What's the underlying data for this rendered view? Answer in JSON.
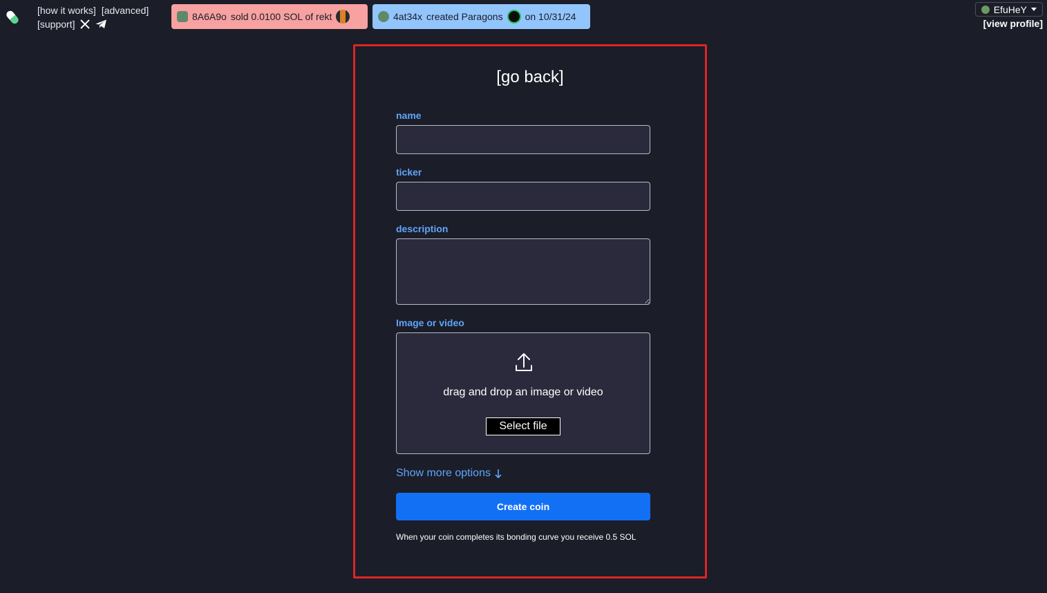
{
  "header": {
    "nav": {
      "how_it_works": "[how it works]",
      "advanced": "[advanced]",
      "support": "[support]"
    },
    "ticker_sell": {
      "user": "8A6A9o",
      "text": "sold 0.0100 SOL of rekt",
      "color": "#f7a1a1"
    },
    "ticker_create": {
      "user": "4at34x",
      "text": "created Paragons",
      "date": "on 10/31/24",
      "color": "#93c5fd"
    },
    "user": {
      "name": "EfuHeY",
      "view_profile": "[view profile]"
    }
  },
  "form": {
    "go_back": "[go back]",
    "name_label": "name",
    "name_value": "",
    "ticker_label": "ticker",
    "ticker_value": "",
    "description_label": "description",
    "description_value": "",
    "media_label": "Image or video",
    "dropzone_text": "drag and drop an image or video",
    "select_file": "Select file",
    "more_options": "Show more options",
    "create_button": "Create coin",
    "footnote": "When your coin completes its bonding curve you receive 0.5 SOL"
  },
  "colors": {
    "background": "#1b1d28",
    "accent": "#1270f5",
    "label": "#60a5fa",
    "panel_border": "#dc2626"
  }
}
